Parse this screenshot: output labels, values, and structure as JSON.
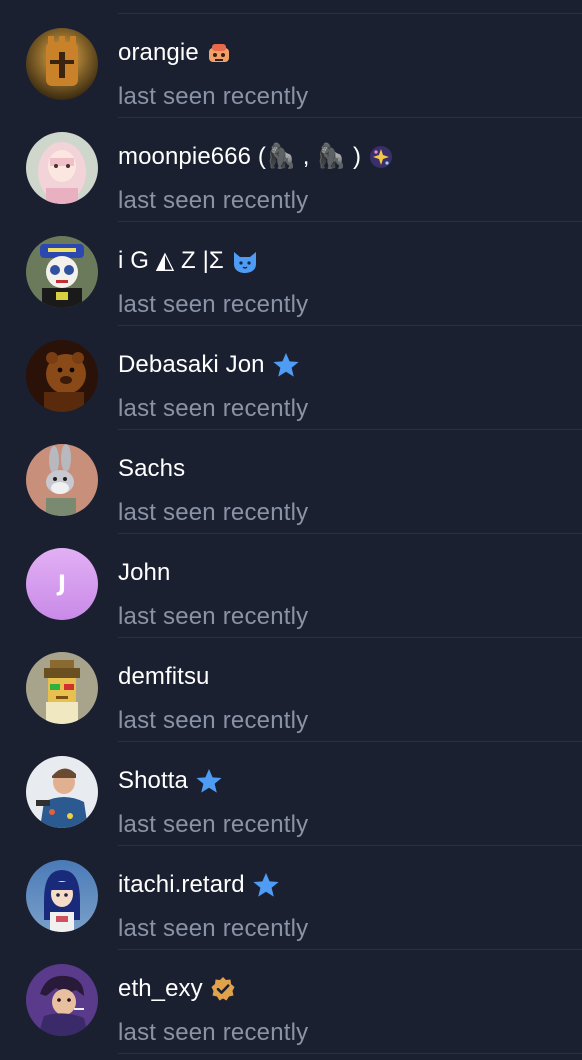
{
  "contacts": [
    {
      "name": "orangie",
      "status": "last seen recently",
      "badge": "emoji-robot-icon",
      "avatar": "knight-avatar"
    },
    {
      "name": "moonpie666 (🦍 , 🦍 )",
      "status": "last seen recently",
      "badge": "sparkles-icon",
      "avatar": "anime-girl-avatar"
    },
    {
      "name": "i G ◭ Z |Σ",
      "status": "last seen recently",
      "badge": "cat-face-icon",
      "avatar": "masked-character-avatar"
    },
    {
      "name": "Debasaki Jon",
      "status": "last seen recently",
      "badge": "star-icon",
      "avatar": "bear-avatar"
    },
    {
      "name": "Sachs",
      "status": "last seen recently",
      "badge": "",
      "avatar": "rabbit-cartoon-avatar"
    },
    {
      "name": "John",
      "status": "last seen recently",
      "badge": "",
      "avatar": "letter-avatar",
      "initial": "J"
    },
    {
      "name": "demfitsu",
      "status": "last seen recently",
      "badge": "",
      "avatar": "pixel-character-avatar"
    },
    {
      "name": "Shotta",
      "status": "last seen recently",
      "badge": "star-icon",
      "avatar": "person-photo-avatar"
    },
    {
      "name": "itachi.retard",
      "status": "last seen recently",
      "badge": "star-icon",
      "avatar": "blue-hair-avatar"
    },
    {
      "name": "eth_exy",
      "status": "last seen recently",
      "badge": "verified-badge-icon",
      "avatar": "anime-character-avatar"
    }
  ],
  "colors": {
    "background": "#1b2030",
    "name": "#ffffff",
    "status": "#8a93a6",
    "divider": "#2b3142",
    "star_badge": "#4f9cf5",
    "verified_badge": "#e0a24a",
    "letter_avatar": "#d9a0f0"
  }
}
